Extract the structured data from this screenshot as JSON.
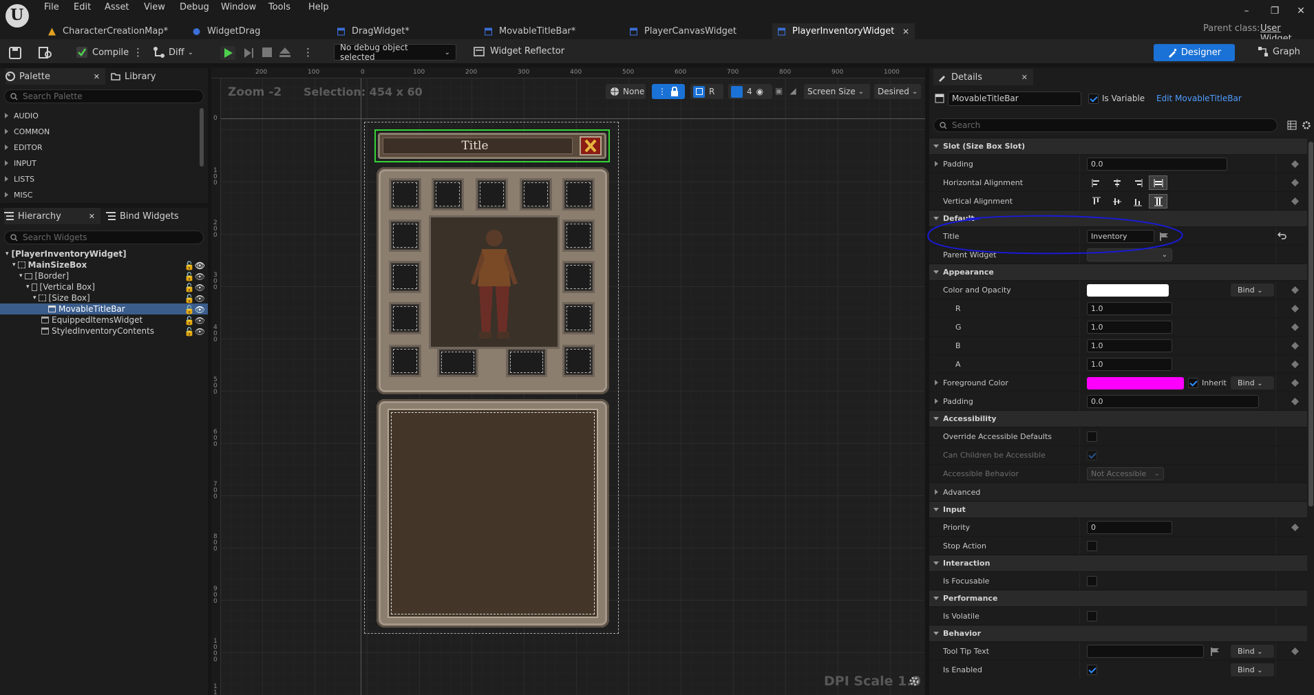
{
  "menu": [
    "File",
    "Edit",
    "Asset",
    "View",
    "Debug",
    "Window",
    "Tools",
    "Help"
  ],
  "tabs": [
    {
      "label": "CharacterCreationMap*"
    },
    {
      "label": "WidgetDrag"
    },
    {
      "label": "DragWidget*"
    },
    {
      "label": "MovableTitleBar*"
    },
    {
      "label": "PlayerCanvasWidget"
    },
    {
      "label": "PlayerInventoryWidget"
    }
  ],
  "parent_class": {
    "label": "Parent class:",
    "value": "User Widget"
  },
  "toolbar": {
    "compile": "Compile",
    "diff": "Diff",
    "debug_select": "No debug object selected",
    "widget_reflector": "Widget Reflector",
    "designer": "Designer",
    "graph": "Graph"
  },
  "palette": {
    "tab": "Palette",
    "library_tab": "Library",
    "search_placeholder": "Search Palette",
    "categories": [
      "AUDIO",
      "COMMON",
      "EDITOR",
      "INPUT",
      "LISTS",
      "MISC"
    ]
  },
  "hierarchy": {
    "tab": "Hierarchy",
    "bind_tab": "Bind Widgets",
    "search_placeholder": "Search Widgets",
    "items": [
      "[PlayerInventoryWidget]",
      "MainSizeBox",
      "[Border]",
      "[Vertical Box]",
      "[Size Box]",
      "MovableTitleBar",
      "EquippedItemsWidget",
      "StyledInventoryContents"
    ]
  },
  "canvas": {
    "zoom": "Zoom -2",
    "selection": "Selection: 454 x 60",
    "dpi": "DPI Scale 1.0",
    "none_label": "None",
    "r_label": "R",
    "grid_count": "4",
    "screen_size": "Screen Size",
    "desired": "Desired",
    "ruler_top": [
      "200",
      "100",
      "0",
      "100",
      "200",
      "300",
      "400",
      "500",
      "600",
      "700",
      "800",
      "900",
      "1000"
    ],
    "ruler_left": [
      "0",
      "1\n0\n0",
      "2\n0\n0",
      "3\n0\n0",
      "4\n0\n0",
      "5\n0\n0",
      "6\n0\n0",
      "7\n0\n0",
      "8\n0\n0",
      "9\n0\n0",
      "1\n0\n0\n0",
      "1\n1"
    ],
    "widget_title": "Title"
  },
  "details": {
    "tab": "Details",
    "widget_name": "MovableTitleBar",
    "is_variable": "Is Variable",
    "edit_link": "Edit MovableTitleBar",
    "search_placeholder": "Search",
    "slot_section": "Slot (Size Box Slot)",
    "padding_label": "Padding",
    "padding_value": "0.0",
    "halign_label": "Horizontal Alignment",
    "valign_label": "Vertical Alignment",
    "default_section": "Default",
    "title_label": "Title",
    "title_value": "Inventory",
    "parent_widget_label": "Parent Widget",
    "appearance_section": "Appearance",
    "color_opacity_label": "Color and Opacity",
    "bind": "Bind",
    "r_label": "R",
    "r_value": "1.0",
    "g_label": "G",
    "g_value": "1.0",
    "b_label": "B",
    "b_value": "1.0",
    "a_label": "A",
    "a_value": "1.0",
    "fg_color_label": "Foreground Color",
    "inherit": "Inherit",
    "padding2_label": "Padding",
    "padding2_value": "0.0",
    "accessibility_section": "Accessibility",
    "override_label": "Override Accessible Defaults",
    "children_label": "Can Children be Accessible",
    "behavior_acc_label": "Accessible Behavior",
    "behavior_acc_value": "Not Accessible",
    "advanced_label": "Advanced",
    "input_section": "Input",
    "priority_label": "Priority",
    "priority_value": "0",
    "stop_action_label": "Stop Action",
    "interaction_section": "Interaction",
    "focusable_label": "Is Focusable",
    "performance_section": "Performance",
    "volatile_label": "Is Volatile",
    "behavior_section": "Behavior",
    "tooltip_label": "Tool Tip Text",
    "enabled_label": "Is Enabled"
  },
  "colors": {
    "accent": "#1b72d6",
    "foreground": "#ff00ff",
    "highlight_circle": "#1a1ad6",
    "selection_green": "#35d435"
  }
}
